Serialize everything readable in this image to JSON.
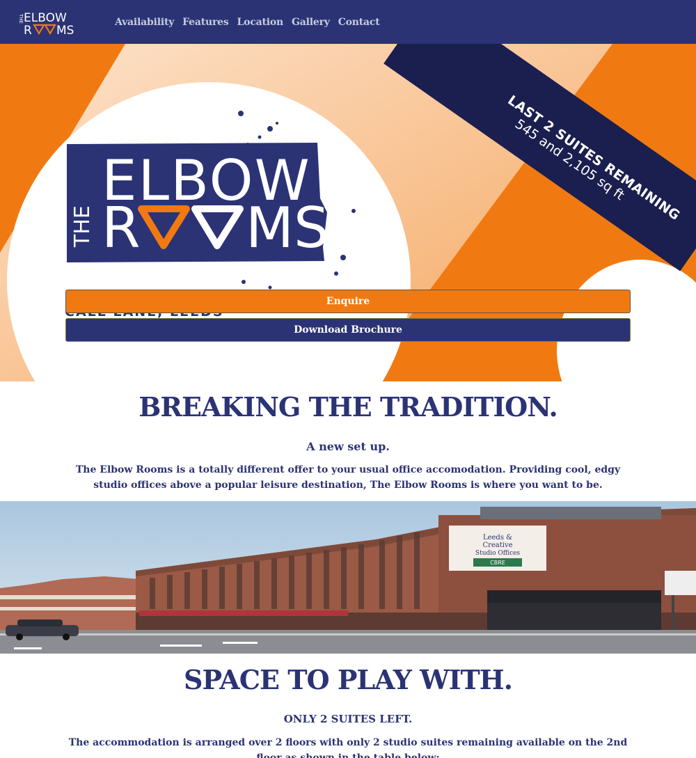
{
  "colors": {
    "navy": "#2b3375",
    "orange": "#f07a11",
    "ribbon": "#1a1f4f",
    "white": "#ffffff"
  },
  "nav": {
    "logo": {
      "line1": "THE",
      "line2": "ELBOW",
      "line3": "ROOMS"
    },
    "links": [
      "Availability",
      "Features",
      "Location",
      "Gallery",
      "Contact"
    ]
  },
  "hero": {
    "logo": {
      "the": "THE",
      "elbow": "ELBOW",
      "rooms_r": "R",
      "rooms_ms": "MS",
      "tagline": "CALL LANE, LEEDS"
    },
    "banner": {
      "title": "LAST 2 SUITES REMAINING",
      "subtitle": "545 and 2,105 sq ft"
    },
    "buttons": {
      "enquire": "Enquire",
      "brochure": "Download Brochure"
    }
  },
  "section1": {
    "heading": "BREAKING THE TRADITION.",
    "subheading": "A new set up.",
    "body": "The Elbow Rooms is a totally different offer to your usual office accomodation. Providing cool, edgy studio offices above a popular leisure destination, The Elbow Rooms is where you want to be."
  },
  "photo": {
    "sign_lines": [
      "Leeds &",
      "Creative",
      "Studio Offices"
    ],
    "sign_cta": "CBRE"
  },
  "section2": {
    "heading": "SPACE TO PLAY WITH.",
    "subheading": "ONLY 2 SUITES LEFT.",
    "body": "The accommodation is arranged over 2 floors with only 2 studio suites remaining available on the 2nd floor as shown in the table below:"
  }
}
